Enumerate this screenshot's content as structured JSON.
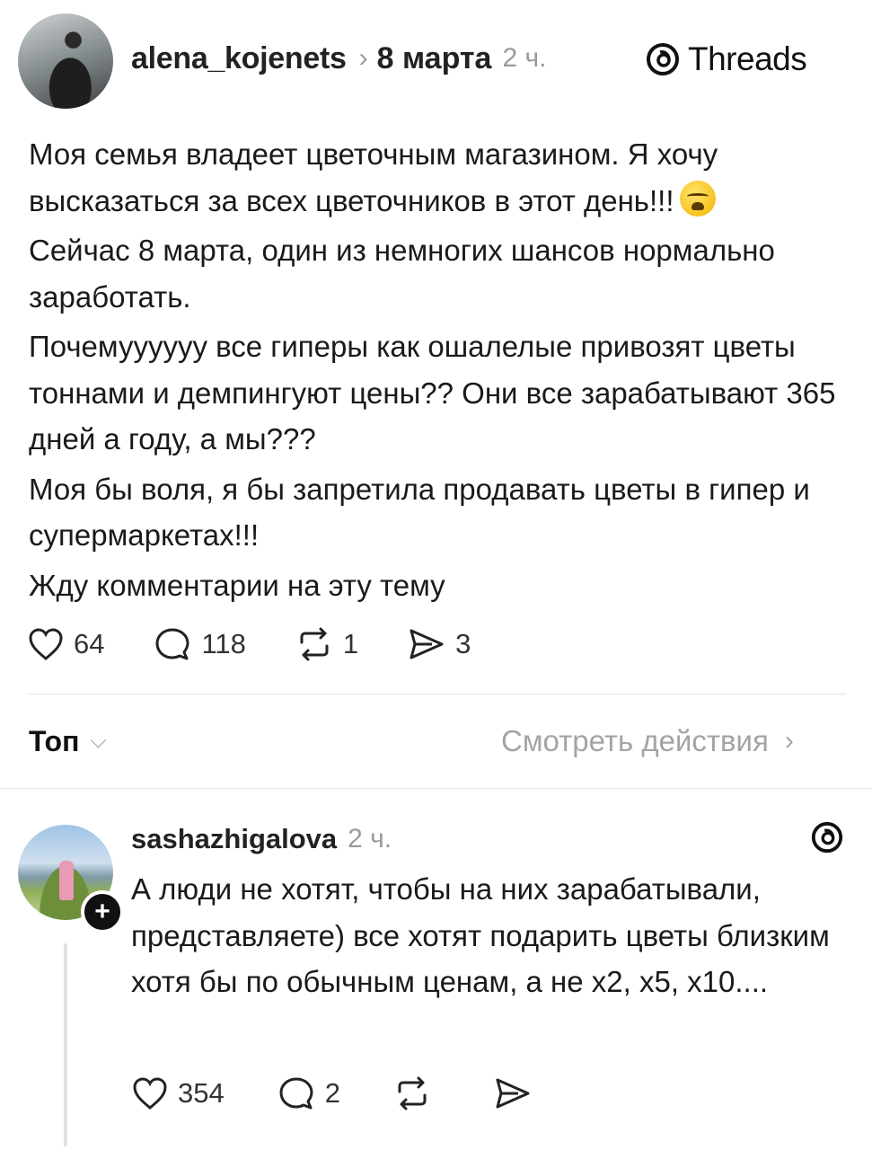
{
  "header": {
    "username": "alena_kojenets",
    "chevron": "›",
    "date": "8 марта",
    "time": "2 ч.",
    "brand": "Threads"
  },
  "post": {
    "paragraphs": [
      "Моя семья владеет цветочным магазином. Я хочу высказаться за всех цветочников в этот день!!!",
      "Сейчас 8 марта, один из немногих шансов нормально заработать.",
      "Почемуууууу все гиперы как ошалелые привозят цветы тоннами и демпингуют цены?? Они все зарабатывают 365 дней а году, а мы???",
      "Моя бы воля, я бы запретила продавать цветы в гипер и супермаркетах!!!",
      "Жду комментарии на эту тему"
    ],
    "emoji": "loudly-crying-face-emoji",
    "likes": "64",
    "comments": "118",
    "reposts": "1",
    "shares": "3"
  },
  "sort": {
    "label": "Топ",
    "dropdown": "⌵",
    "activity": "Смотреть действия",
    "activity_chevron": "›"
  },
  "reply": {
    "username": "sashazhigalova",
    "time": "2 ч.",
    "plus": "+",
    "text": "А люди не хотят, чтобы на них зарабатывали, представляете) все хотят подарить цветы близким хотя бы по обычным ценам, а не х2, х5, х10....",
    "likes": "354",
    "comments": "2"
  },
  "icons": {
    "like": "heart-icon",
    "comment": "comment-bubble-icon",
    "repost": "repost-icon",
    "share": "send-icon",
    "brand": "threads-logo-icon"
  }
}
